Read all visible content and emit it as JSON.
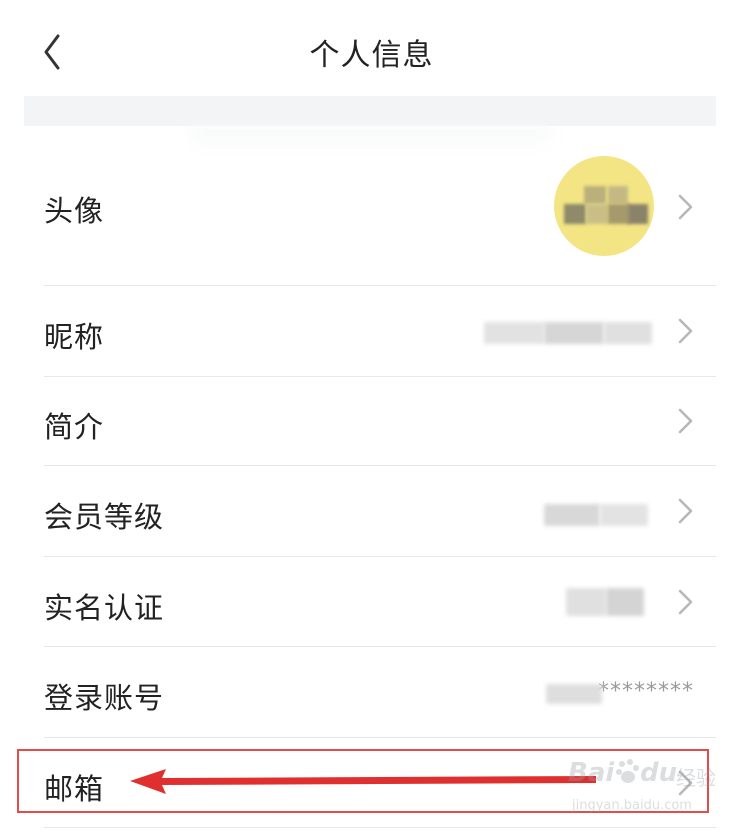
{
  "header": {
    "title": "个人信息"
  },
  "rows": [
    {
      "label": "头像"
    },
    {
      "label": "昵称"
    },
    {
      "label": "简介"
    },
    {
      "label": "会员等级"
    },
    {
      "label": "实名认证"
    },
    {
      "label": "登录账号",
      "masked_value": "********"
    },
    {
      "label": "邮箱"
    }
  ],
  "watermark": {
    "brand": "Bai",
    "brand2": "du",
    "cn": "经验",
    "url": "jingyan.baidu.com"
  },
  "colors": {
    "highlight": "#e34c4c",
    "arrow": "#e02f2f",
    "avatar_bg": "#f3e584"
  },
  "icons": {
    "back": "chevron-left-icon",
    "row_arrow": "chevron-right-icon"
  }
}
